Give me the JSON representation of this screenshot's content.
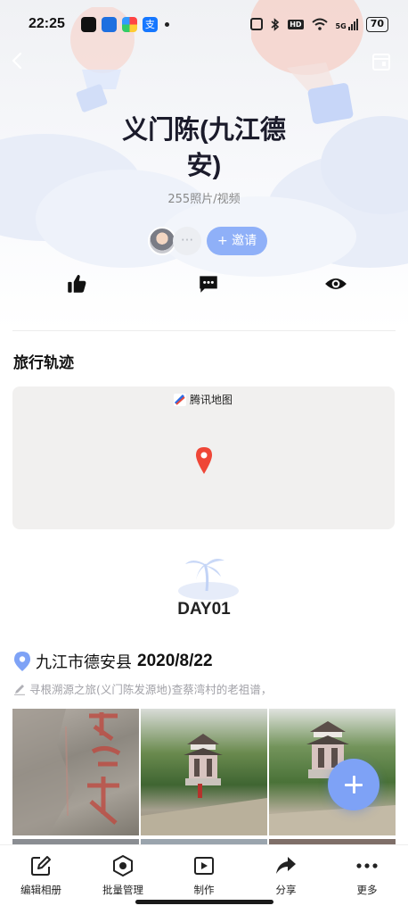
{
  "status_bar": {
    "time": "22:25",
    "network_label": "5G",
    "battery": "70"
  },
  "album": {
    "title": "义门陈(九江德安)",
    "count_text": "255照片/视频",
    "invite_label": "+ 邀请",
    "member_more": "···"
  },
  "actions": [
    "like-icon",
    "comment-icon",
    "view-icon"
  ],
  "track": {
    "section_title": "旅行轨迹",
    "map_brand": "腾讯地图"
  },
  "day": {
    "label": "DAY01",
    "location": "九江市德安县",
    "date": "2020/8/22",
    "note": "寻根溯源之旅(义门陈发源地)查蔡湾村的老祖谱，"
  },
  "tabbar": {
    "items": [
      {
        "label": "编辑相册",
        "icon": "edit-icon"
      },
      {
        "label": "批量管理",
        "icon": "batch-icon"
      },
      {
        "label": "制作",
        "icon": "make-video-icon"
      },
      {
        "label": "分享",
        "icon": "share-icon"
      },
      {
        "label": "更多",
        "icon": "more-icon"
      }
    ]
  },
  "colors": {
    "accent": "#8fb0f8",
    "fab": "#7ea2f6",
    "pin": "#ef4637"
  }
}
